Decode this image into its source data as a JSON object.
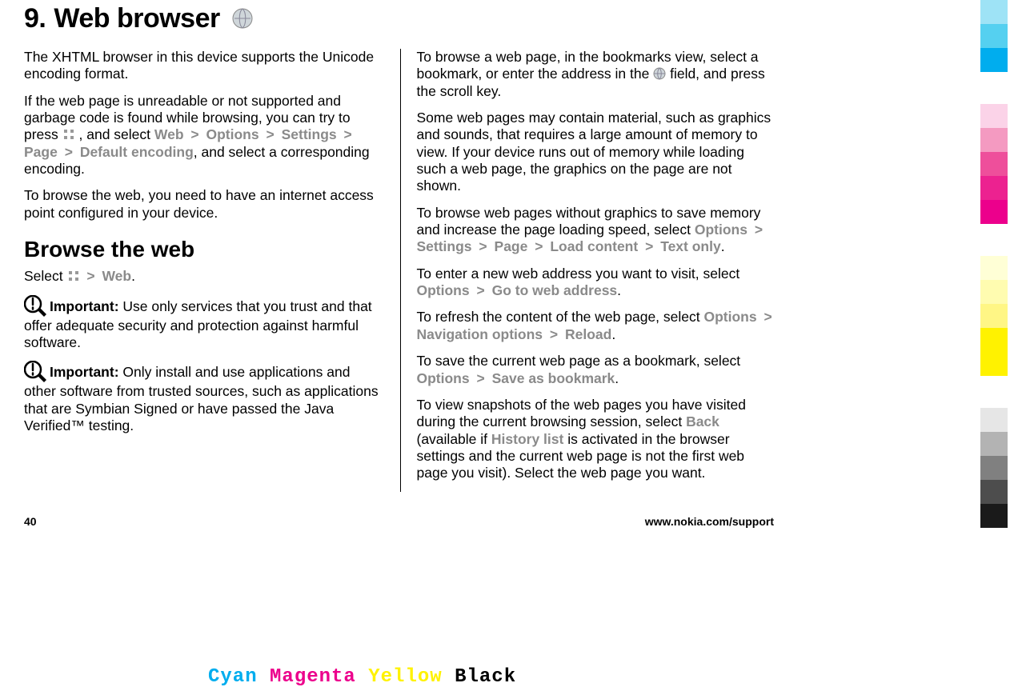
{
  "chapter": {
    "number": "9.",
    "title": "Web browser"
  },
  "left": {
    "p1_a": "The XHTML browser in this device supports the Unicode encoding format.",
    "p2_a": "If the web page is unreadable or not supported and garbage code is found while browsing, you can try to press ",
    "p2_b": " , and select ",
    "p2_m1": "Web",
    "p2_m2": "Options",
    "p2_m3": "Settings",
    "p2_m4": "Page",
    "p2_m5": "Default encoding",
    "p2_c": ", and select a corresponding encoding.",
    "p3": "To browse the web, you need to have an internet access point configured in your device.",
    "section": "Browse the web",
    "sel_a": "Select ",
    "sel_b": " > ",
    "sel_m": "Web",
    "sel_dot": ".",
    "imp1_label": "Important:",
    "imp1_text": "  Use only services that you trust and that offer adequate security and protection against harmful software.",
    "imp2_label": "Important:",
    "imp2_text": "  Only install and use applications and other software from trusted sources, such as applications that are Symbian Signed or have passed the Java Verified™ testing."
  },
  "right": {
    "p1_a": "To browse a web page, in the bookmarks view, select a bookmark, or enter the address in the ",
    "p1_b": " field, and press the scroll key.",
    "p2": "Some web pages may contain material, such as graphics and sounds, that requires a large amount of memory to view. If your device runs out of memory while loading such a web page, the graphics on the page are not shown.",
    "p3_a": "To browse web pages without graphics to save memory and increase the page loading speed, select ",
    "p3_m1": "Options",
    "p3_m2": "Settings",
    "p3_m3": "Page",
    "p3_m4": "Load content",
    "p3_m5": "Text only",
    "p3_dot": ".",
    "p4_a": "To enter a new web address you want to visit, select ",
    "p4_m1": "Options",
    "p4_m2": "Go to web address",
    "p4_dot": ".",
    "p5_a": "To refresh the content of the web page, select ",
    "p5_m1": "Options",
    "p5_m2": "Navigation options",
    "p5_m3": "Reload",
    "p5_dot": ".",
    "p6_a": "To save the current web page as a bookmark, select ",
    "p6_m1": "Options",
    "p6_m2": "Save as bookmark",
    "p6_dot": ".",
    "p7_a": "To view snapshots of the web pages you have visited during the current browsing session, select ",
    "p7_m1": "Back",
    "p7_b": " (available if ",
    "p7_m2": "History list",
    "p7_c": " is activated in the browser settings and the current web page is not the first web page you visit). Select the web page you want."
  },
  "footer": {
    "page": "40",
    "url": "www.nokia.com/support"
  },
  "sep": ">",
  "cmyk": {
    "c": "Cyan",
    "m": "Magenta",
    "y": "Yellow",
    "k": "Black"
  },
  "bars": {
    "cyan": [
      "#9ee3f6",
      "#55d0f0",
      "#00adee"
    ],
    "magenta": [
      "#fbd3e8",
      "#f49ac1",
      "#ee4f9b",
      "#ec2290",
      "#ec008c"
    ],
    "yellow": [
      "#ffffd6",
      "#fffcb0",
      "#fff685",
      "#fff200",
      "#fff200"
    ],
    "gray": [
      "#e6e6e6",
      "#b3b3b3",
      "#808080",
      "#4d4d4d",
      "#1a1a1a"
    ]
  }
}
